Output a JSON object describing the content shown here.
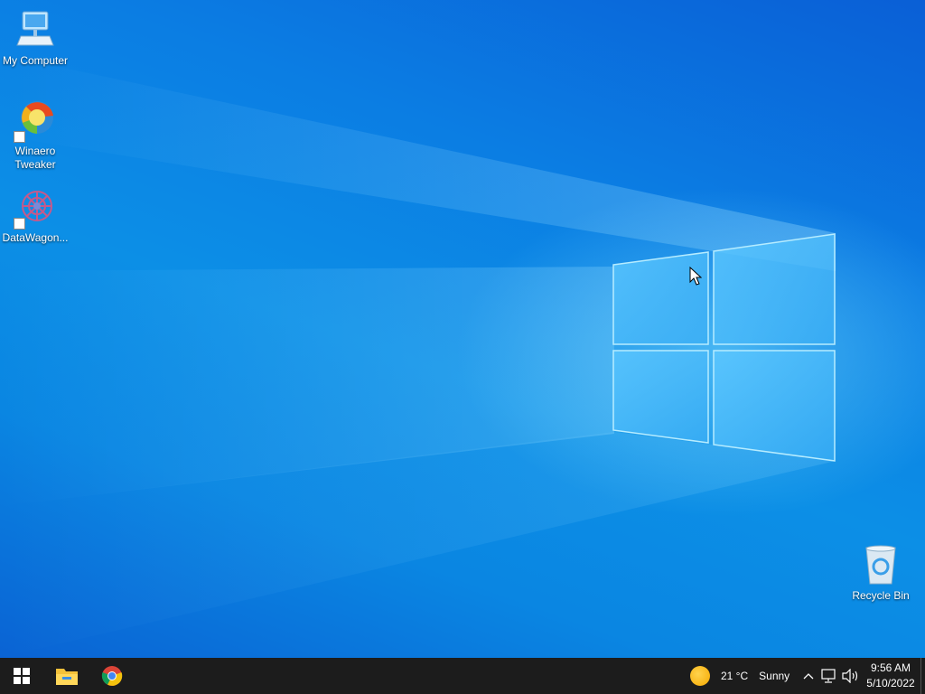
{
  "desktop": {
    "icons": [
      {
        "label": "My Computer",
        "icon": "computer-icon"
      },
      {
        "label": "Winaero Tweaker",
        "icon": "winaero-tweaker-icon"
      },
      {
        "label": "DataWagon...",
        "icon": "datawagon-icon"
      },
      {
        "label": "Recycle Bin",
        "icon": "recycle-bin-icon"
      }
    ],
    "wallpaper_accent": "#0c8fe6"
  },
  "taskbar": {
    "background": "#1c1c1c",
    "apps": [
      {
        "icon": "windows-start-icon"
      },
      {
        "icon": "file-explorer-icon"
      },
      {
        "icon": "chrome-icon"
      }
    ],
    "weather": {
      "temp": "21 °C",
      "condition": "Sunny",
      "icon": "sun-icon"
    },
    "tray": {
      "icons": [
        "chevron-up-icon",
        "network-icon",
        "volume-icon"
      ]
    },
    "clock": {
      "time": "9:56 AM",
      "date": "5/10/2022"
    }
  }
}
